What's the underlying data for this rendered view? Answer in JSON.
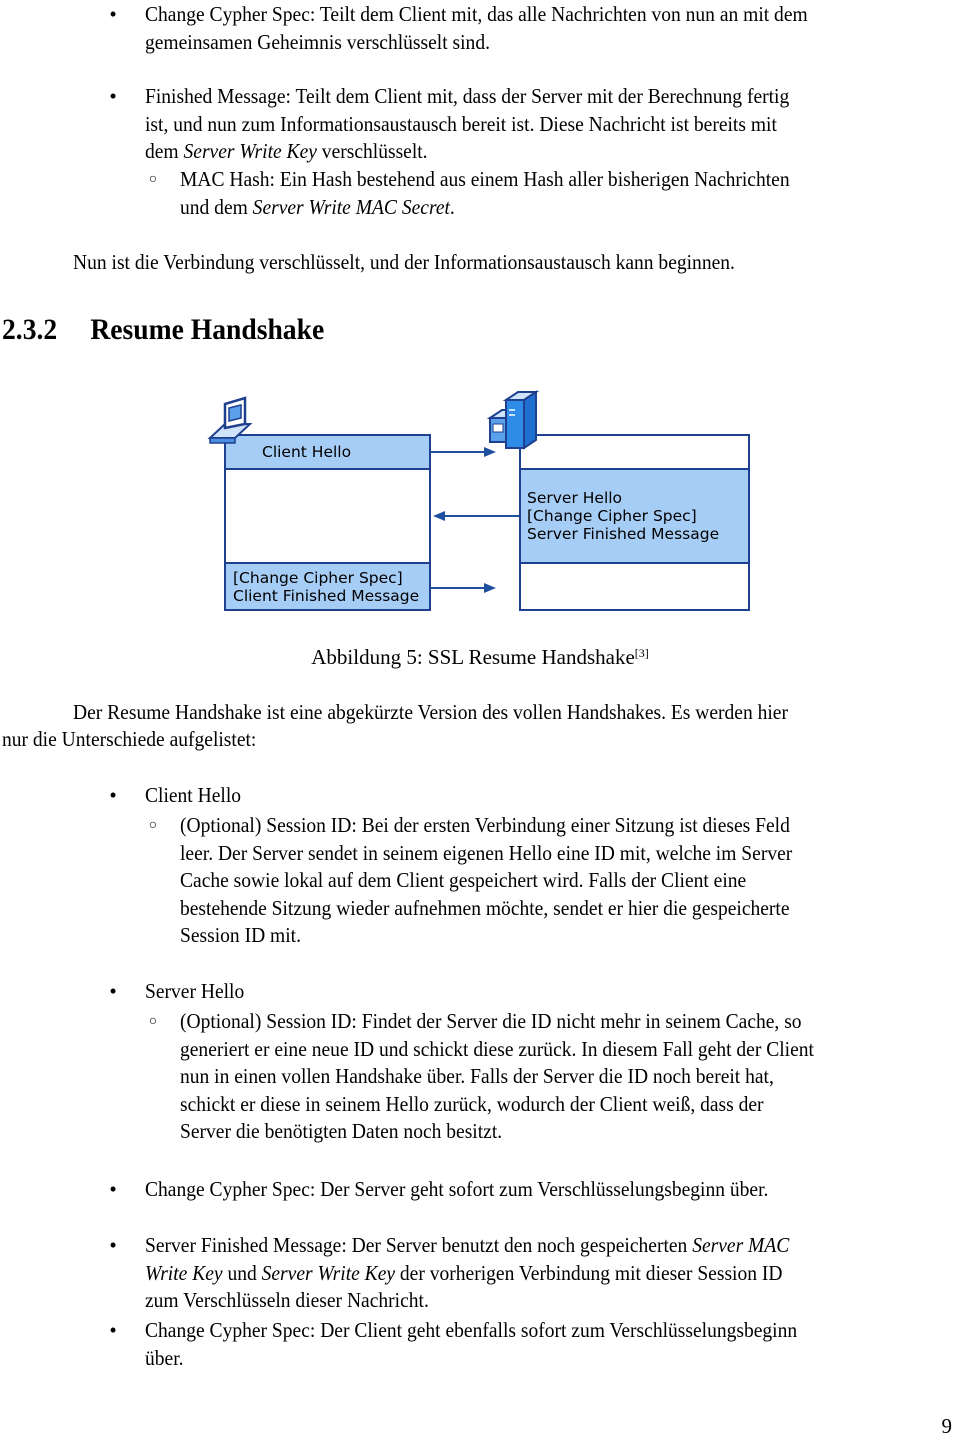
{
  "top_list": [
    {
      "bullet": "•",
      "lines": [
        "Change Cypher Spec: Teilt dem Client mit, das alle Nachrichten von nun an mit dem",
        "gemeinsamen Geheimnis verschlüsselt sind."
      ]
    },
    {
      "bullet": "•",
      "lines": [
        "Finished Message: Teilt dem Client mit, dass der Server mit der Berechnung fertig",
        "ist, und nun zum Informationsaustausch bereit ist. Diese Nachricht ist bereits mit"
      ],
      "line3_prefix": "dem ",
      "line3_italic": "Server Write Key",
      "line3_suffix": " verschlüsselt.",
      "sub": {
        "bullet": "○",
        "line1": "MAC Hash: Ein Hash bestehend aus einem Hash aller bisherigen Nachrichten",
        "line2_prefix": "und dem ",
        "line2_italic": "Server Write MAC Secret",
        "line2_suffix": "."
      }
    }
  ],
  "conclusion": "Nun ist die Verbindung verschlüsselt, und der Informationsaustausch kann beginnen.",
  "section": {
    "number": "2.3.2",
    "title": "Resume Handshake"
  },
  "diagram": {
    "client_hello": "Client Hello",
    "server_lines": [
      "Server Hello",
      "[Change Cipher Spec]",
      "Server Finished Message"
    ],
    "client_lines": [
      "[Change Cipher Spec]",
      "Client Finished Message"
    ],
    "colors": {
      "fill": "#a6cdf5",
      "border": "#1f3f8f",
      "arrow": "#1f4f9f",
      "icon_dark": "#1f3f8f",
      "icon_light": "#2f8be8"
    }
  },
  "caption": {
    "text": "Abbildung 5: SSL Resume Handshake",
    "ref": "[3]"
  },
  "intro": {
    "line1": "Der Resume Handshake ist eine abgekürzte Version des vollen Handshakes. Es werden hier",
    "line2": "nur die Unterschiede aufgelistet:"
  },
  "diff_list": [
    {
      "bullet": "•",
      "title": "Client Hello",
      "sub_bullet": "○",
      "sub_lines": [
        "(Optional) Session ID: Bei der ersten Verbindung einer Sitzung ist dieses Feld",
        "leer. Der Server sendet in seinem eigenen Hello eine ID mit, welche im Server",
        "Cache sowie lokal auf dem Client gespeichert wird. Falls der Client eine",
        "bestehende Sitzung wieder aufnehmen möchte, sendet er hier die gespeicherte",
        "Session ID mit."
      ]
    },
    {
      "bullet": "•",
      "title": "Server Hello",
      "sub_bullet": "○",
      "sub_lines": [
        "(Optional) Session ID: Findet der Server die ID nicht mehr in seinem Cache, so",
        "generiert er eine neue ID und schickt diese zurück. In diesem Fall geht der Client",
        "nun in einen vollen Handshake über. Falls der Server die ID noch bereit hat,",
        "schickt er diese in seinem Hello zurück, wodurch der Client weiß, dass der",
        "Server die benötigten Daten noch besitzt."
      ]
    },
    {
      "bullet": "•",
      "text": "Change Cypher Spec: Der Server geht sofort zum Verschlüsselungsbeginn über."
    },
    {
      "bullet": "•",
      "l1_prefix": "Server Finished Message: Der Server benutzt den noch gespeicherten ",
      "l1_italic": "Server MAC",
      "l2_italic_a": "Write Key",
      "l2_mid": " und ",
      "l2_italic_b": "Server Write Key",
      "l2_suffix": " der vorherigen Verbindung mit dieser Session ID",
      "l3": "zum Verschlüsseln dieser Nachricht."
    },
    {
      "bullet": "•",
      "lines": [
        "Change Cypher Spec: Der Client geht ebenfalls sofort zum Verschlüsselungsbeginn",
        "über."
      ]
    }
  ],
  "page_number": "9"
}
